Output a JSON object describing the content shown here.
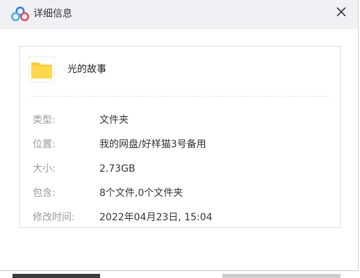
{
  "window": {
    "title": "详细信息",
    "accent": "#2f7cf6"
  },
  "item": {
    "name": "光的故事",
    "icon": "folder-icon",
    "icon_color": "#ffcb2f"
  },
  "details": [
    {
      "label": "类型:",
      "value": "文件夹"
    },
    {
      "label": "位置:",
      "value": "我的网盘/好样猫3号备用"
    },
    {
      "label": "大小:",
      "value": "2.73GB"
    },
    {
      "label": "包含:",
      "value": "8个文件,0个文件夹"
    },
    {
      "label": "修改时间:",
      "value": "2022年04月23日, 15:04"
    }
  ]
}
